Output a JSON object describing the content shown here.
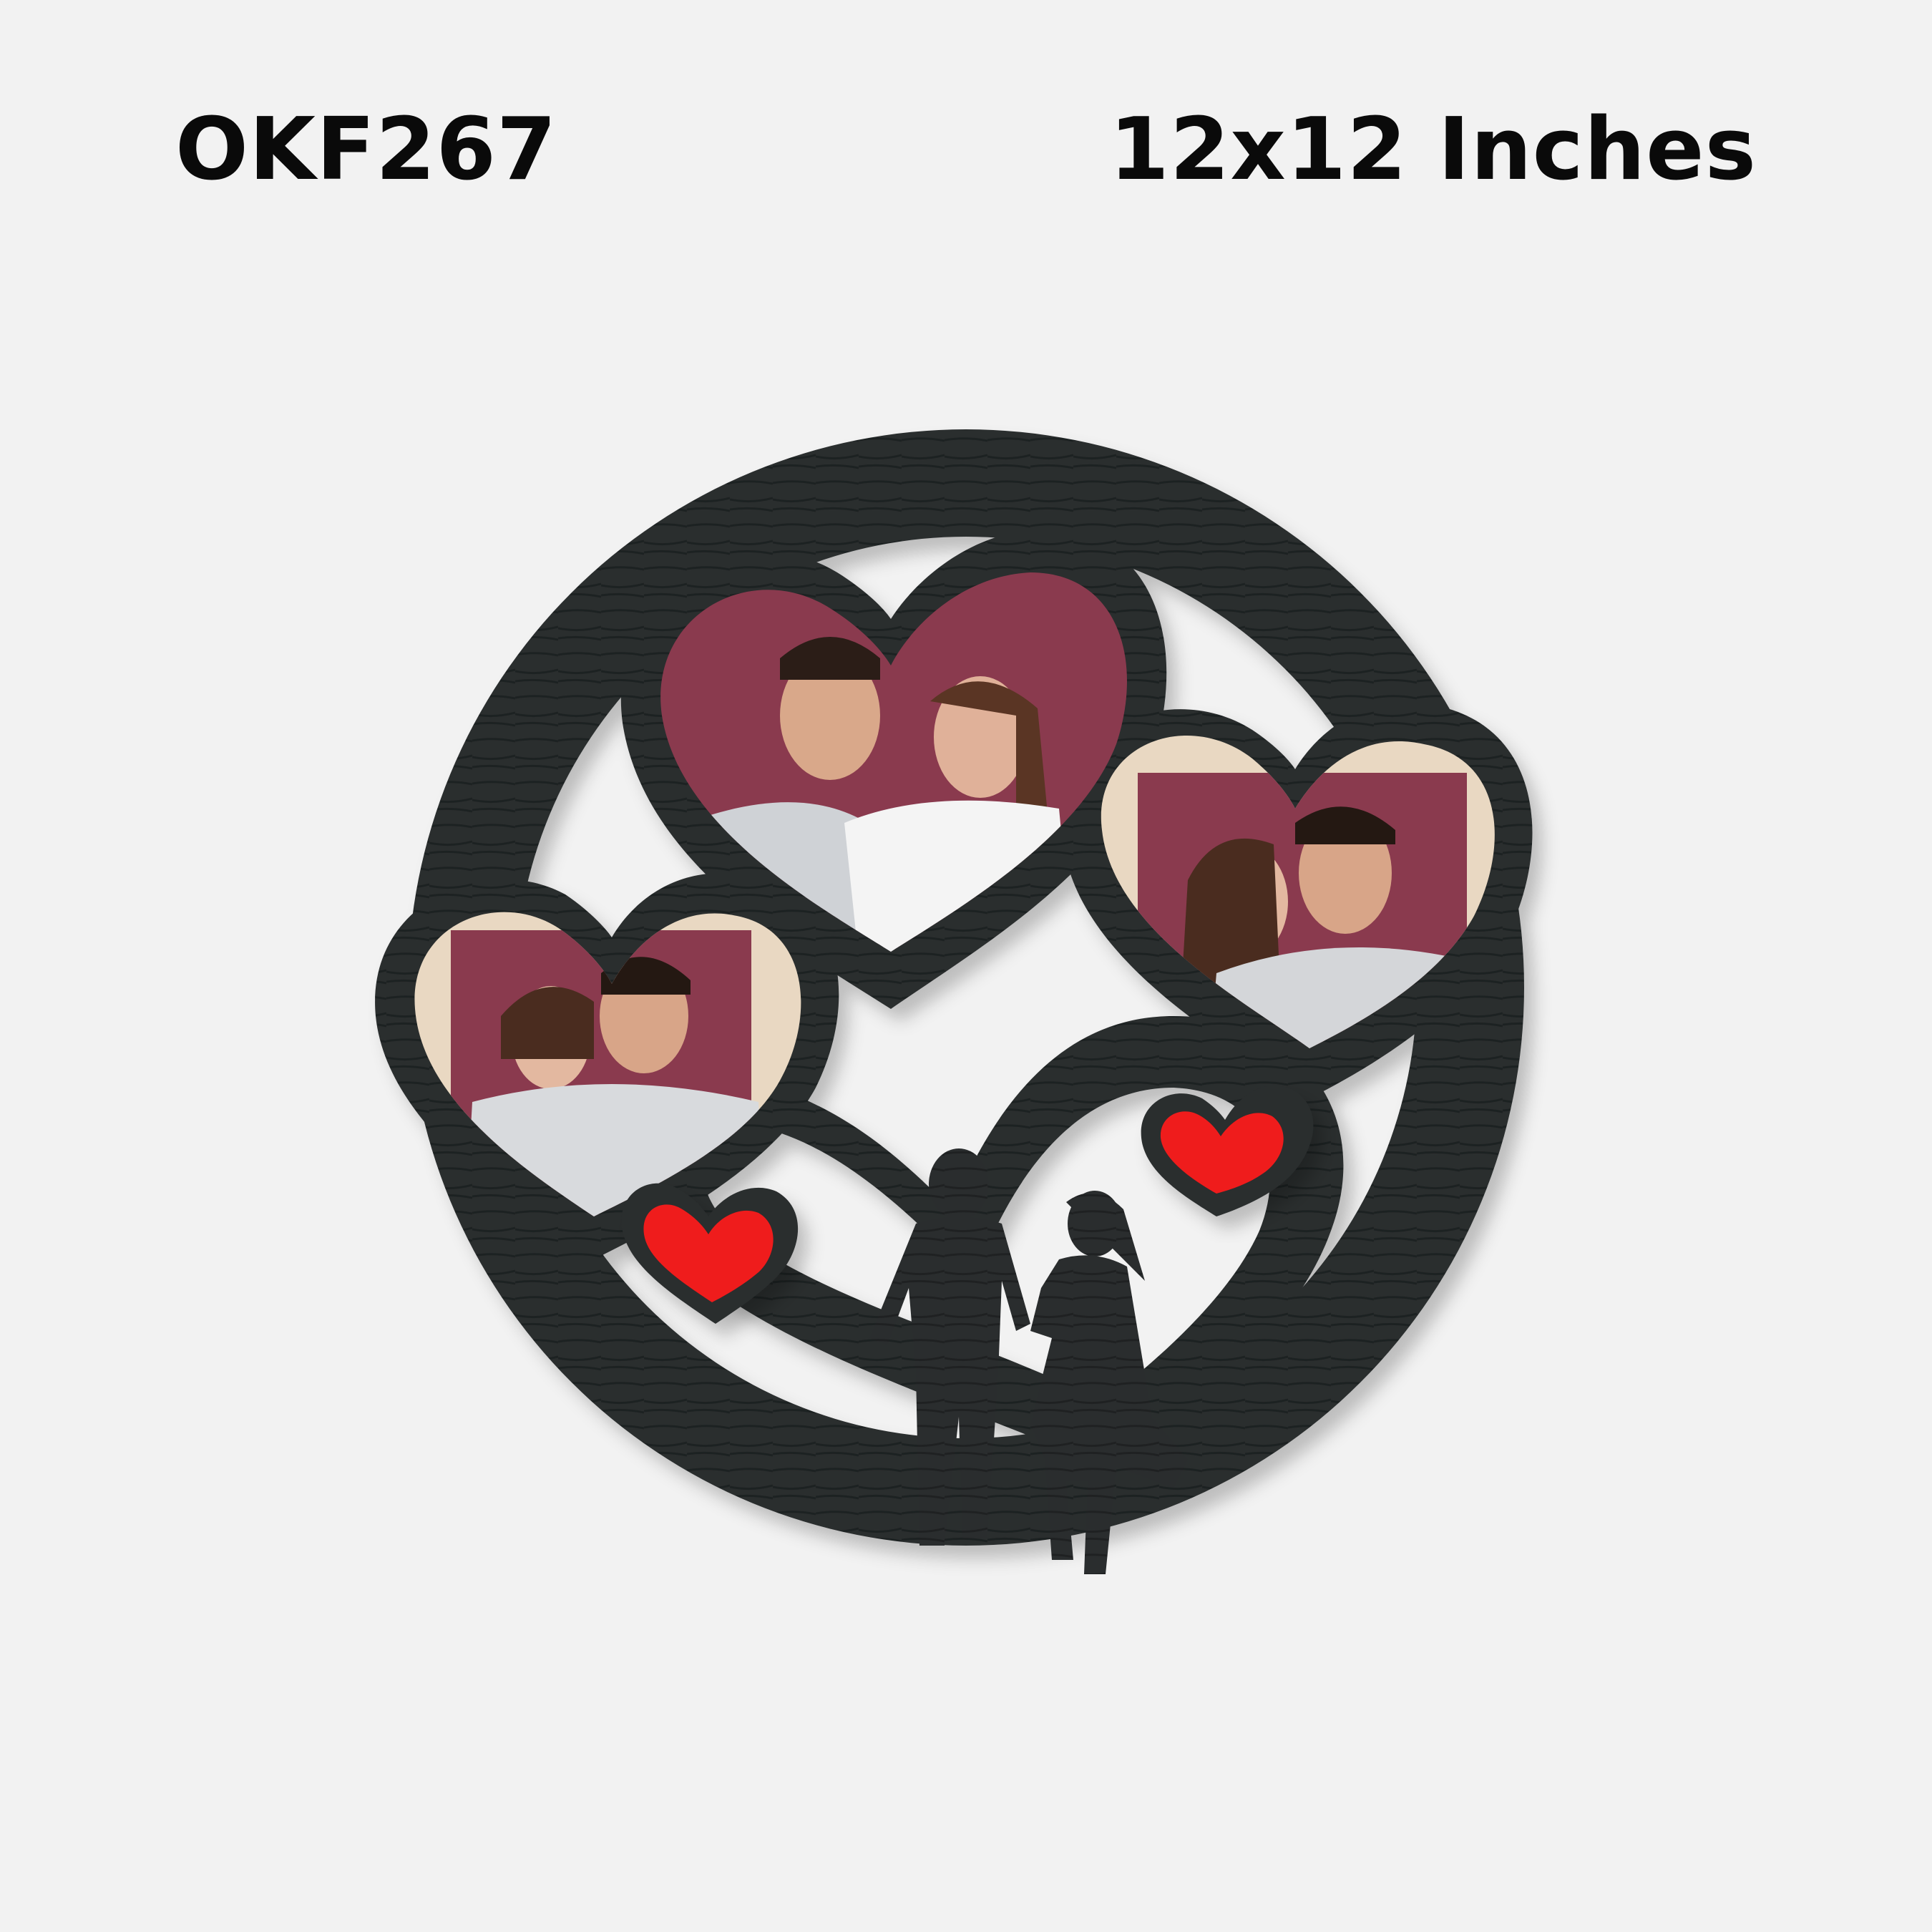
{
  "product": {
    "code": "OKF267",
    "size": "12x12 Inches"
  },
  "colors": {
    "background": "#f2f2f2",
    "frame": "#2a2d2e",
    "photo_backdrop": "#8a3a4e",
    "accent_heart": "#ef1b1b"
  },
  "frame": {
    "photo_slots": [
      {
        "name": "top-center-photo"
      },
      {
        "name": "right-photo"
      },
      {
        "name": "left-photo"
      }
    ],
    "decor": [
      "red-heart-left",
      "red-heart-right",
      "couple-silhouette"
    ]
  }
}
